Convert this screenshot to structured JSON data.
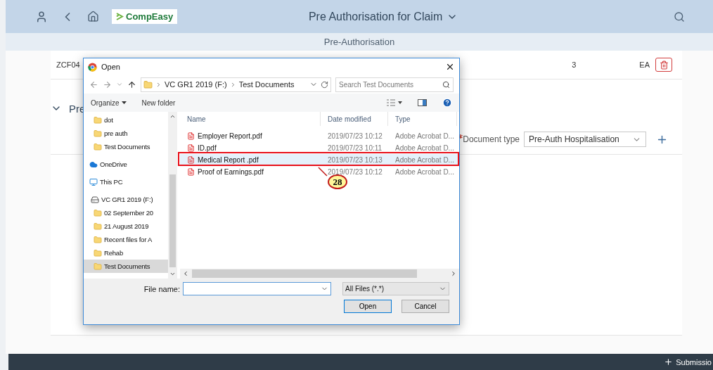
{
  "header": {
    "logo": "CompEasy",
    "title": "Pre Authorisation for Claim"
  },
  "subheader": {
    "title": "Pre-Authorisation"
  },
  "item_row": {
    "code": "ZCF04",
    "quantity": "3",
    "unit": "EA"
  },
  "section": {
    "title": "Pre",
    "expanded": true
  },
  "document_type": {
    "label": "Document type",
    "required": true,
    "value": "Pre-Auth Hospitalisation"
  },
  "footer": {
    "button": "Submissio"
  },
  "dialog": {
    "title": "Open",
    "path": [
      "VC GR1 2019 (F:)",
      "Test Documents"
    ],
    "search": {
      "placeholder": "Search Test Documents"
    },
    "organize": "Organize",
    "new_folder": "New folder",
    "nav": [
      {
        "label": "dot",
        "kind": "folder",
        "selected": false
      },
      {
        "label": "pre auth",
        "kind": "folder",
        "selected": false
      },
      {
        "label": "Test Documents",
        "kind": "folder",
        "selected": false
      },
      {
        "label": "OneDrive",
        "kind": "cloud",
        "selected": false
      },
      {
        "label": "This PC",
        "kind": "pc",
        "selected": false
      },
      {
        "label": "VC GR1 2019 (F:)",
        "kind": "drive",
        "selected": false,
        "children": [
          {
            "label": "02 September 20",
            "kind": "folder",
            "selected": false
          },
          {
            "label": "21 August 2019",
            "kind": "folder",
            "selected": false
          },
          {
            "label": "Recent files for A",
            "kind": "folder",
            "selected": false
          },
          {
            "label": "Rehab",
            "kind": "folder",
            "selected": false
          },
          {
            "label": "Test Documents",
            "kind": "folder",
            "selected": true
          }
        ]
      }
    ],
    "columns": [
      "Name",
      "Date modified",
      "Type"
    ],
    "files": [
      {
        "name": "Employer Report.pdf",
        "date": "2019/07/23 10:12",
        "type": "Adobe Acrobat D...",
        "selected": false
      },
      {
        "name": "ID.pdf",
        "date": "2019/07/23 10:11",
        "type": "Adobe Acrobat D...",
        "selected": false
      },
      {
        "name": "Medical Report .pdf",
        "date": "2019/07/23 10:13",
        "type": "Adobe Acrobat D...",
        "selected": true
      },
      {
        "name": "Proof of Earnings.pdf",
        "date": "2019/07/23 10:12",
        "type": "Adobe Acrobat D...",
        "selected": false
      }
    ],
    "file_name_label": "File name:",
    "file_type": "All Files (*.*)",
    "buttons": [
      "Open",
      "Cancel"
    ]
  },
  "callout": {
    "number": "28"
  }
}
